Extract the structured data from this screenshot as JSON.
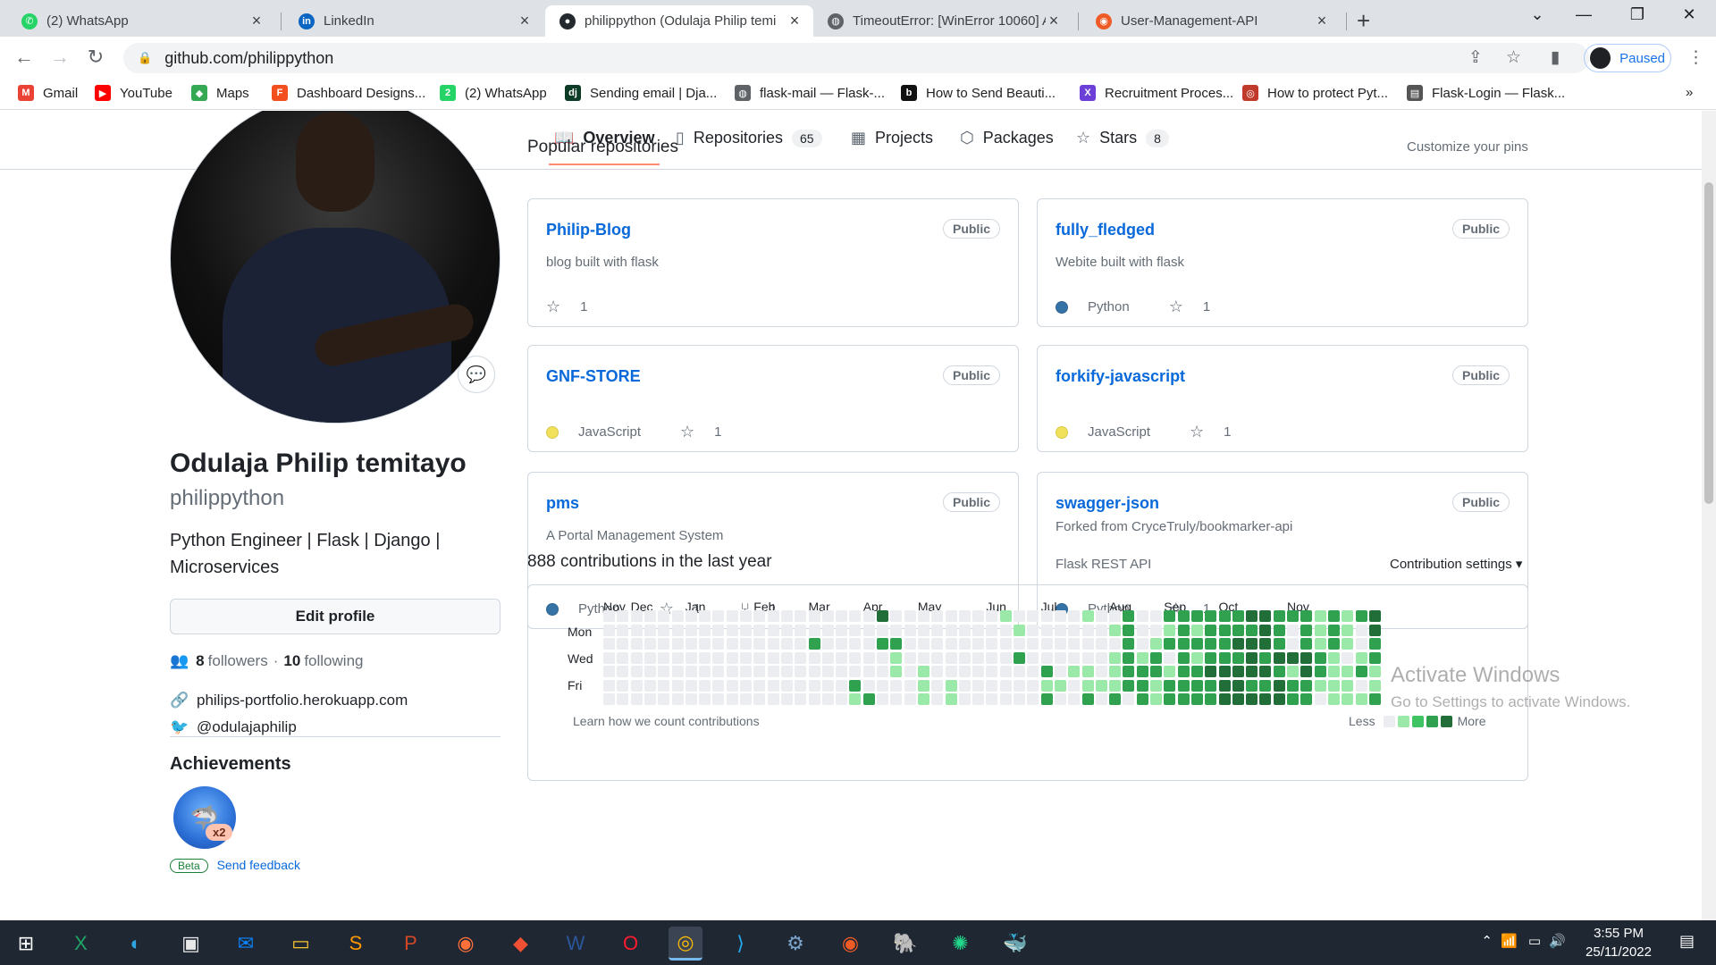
{
  "browser": {
    "tabs": [
      {
        "title": "(2) WhatsApp",
        "icon": "whatsapp-icon",
        "color": "#25d366",
        "glyph": "✆"
      },
      {
        "title": "LinkedIn",
        "icon": "linkedin-icon",
        "color": "#0a66c2",
        "glyph": "in"
      },
      {
        "title": "philippython (Odulaja Philip temi",
        "icon": "github-icon",
        "color": "#24292f",
        "glyph": "●"
      },
      {
        "title": "TimeoutError: [WinError 10060] A",
        "icon": "globe-icon",
        "color": "#5f6368",
        "glyph": "◍"
      },
      {
        "title": "User-Management-API",
        "icon": "postman-icon",
        "color": "#ef5b25",
        "glyph": "◉"
      }
    ],
    "url": "github.com/philippython",
    "profile_status": "Paused",
    "bookmarks": [
      {
        "label": "Gmail",
        "icon": "gmail-icon",
        "color": "#ea4335",
        "glyph": "M"
      },
      {
        "label": "YouTube",
        "icon": "youtube-icon",
        "color": "#ff0000",
        "glyph": "▶"
      },
      {
        "label": "Maps",
        "icon": "maps-icon",
        "color": "#34a853",
        "glyph": "◆"
      },
      {
        "label": "Dashboard Designs...",
        "icon": "figma-icon",
        "color": "#f24e1e",
        "glyph": "F"
      },
      {
        "label": "(2) WhatsApp",
        "icon": "whatsapp-icon",
        "color": "#25d366",
        "glyph": "2"
      },
      {
        "label": "Sending email | Dja...",
        "icon": "django-icon",
        "color": "#0c3c26",
        "glyph": "dj"
      },
      {
        "label": "flask-mail — Flask-...",
        "icon": "globe-icon",
        "color": "#5f6368",
        "glyph": "◍"
      },
      {
        "label": "How to Send Beauti...",
        "icon": "bds-icon",
        "color": "#111111",
        "glyph": "b"
      },
      {
        "label": "Recruitment Proces...",
        "icon": "x-icon",
        "color": "#6b3fd8",
        "glyph": "X"
      },
      {
        "label": "How to protect Pyt...",
        "icon": "site-icon",
        "color": "#c0392b",
        "glyph": "◎"
      },
      {
        "label": "Flask-Login — Flask...",
        "icon": "book-icon",
        "color": "#555555",
        "glyph": "▤"
      }
    ]
  },
  "github": {
    "tabs": [
      {
        "label": "Overview",
        "count": "",
        "icon": "book-icon",
        "glyph": "📖"
      },
      {
        "label": "Repositories",
        "count": "65",
        "icon": "repo-icon",
        "glyph": "▯"
      },
      {
        "label": "Projects",
        "count": "",
        "icon": "table-icon",
        "glyph": "▦"
      },
      {
        "label": "Packages",
        "count": "",
        "icon": "package-icon",
        "glyph": "⬡"
      },
      {
        "label": "Stars",
        "count": "8",
        "icon": "star-icon",
        "glyph": "☆"
      }
    ],
    "profile": {
      "fullname": "Odulaja Philip temitayo",
      "username": "philippython",
      "bio": "Python Engineer | Flask | Django | Microservices",
      "edit_button": "Edit profile",
      "followers_count": "8",
      "followers_label": "followers",
      "separator": "·",
      "following_count": "10",
      "following_label": "following",
      "website": "philips-portfolio.herokuapp.com",
      "twitter": "@odulajaphilip",
      "achievements_title": "Achievements",
      "badge_count": "x2",
      "beta_label": "Beta",
      "feedback_label": "Send feedback"
    },
    "popular": {
      "title": "Popular repositories",
      "customize": "Customize your pins",
      "repos": [
        {
          "name": "Philip-Blog",
          "visibility": "Public",
          "forked_from": "",
          "description": "blog built with flask",
          "language": "",
          "lang_color": "",
          "stars": "1",
          "forks": ""
        },
        {
          "name": "fully_fledged",
          "visibility": "Public",
          "forked_from": "",
          "description": "Webite built with flask",
          "language": "Python",
          "lang_color": "#3572A5",
          "stars": "1",
          "forks": ""
        },
        {
          "name": "GNF-STORE",
          "visibility": "Public",
          "forked_from": "",
          "description": "",
          "language": "JavaScript",
          "lang_color": "#f1e05a",
          "stars": "1",
          "forks": ""
        },
        {
          "name": "forkify-javascript",
          "visibility": "Public",
          "forked_from": "",
          "description": "",
          "language": "JavaScript",
          "lang_color": "#f1e05a",
          "stars": "1",
          "forks": ""
        },
        {
          "name": "pms",
          "visibility": "Public",
          "forked_from": "",
          "description": "A Portal Management System",
          "language": "Python",
          "lang_color": "#3572A5",
          "stars": "1",
          "forks": "1"
        },
        {
          "name": "swagger-json",
          "visibility": "Public",
          "forked_from": "Forked from CryceTruly/bookmarker-api",
          "description": "Flask REST API",
          "language": "Python",
          "lang_color": "#3572A5",
          "stars": "1",
          "forks": ""
        }
      ]
    },
    "contributions": {
      "title": "888 contributions in the last year",
      "settings": "Contribution settings ▾",
      "months": [
        "Nov",
        "Dec",
        "Jan",
        "Feb",
        "Mar",
        "Apr",
        "May",
        "Jun",
        "Jul",
        "Aug",
        "Sep",
        "Oct",
        "Nov"
      ],
      "month_weeks": [
        0,
        2,
        6,
        11,
        15,
        19,
        23,
        28,
        32,
        37,
        41,
        45,
        50
      ],
      "days": [
        "Mon",
        "Wed",
        "Fri"
      ],
      "learn": "Learn how we count contributions",
      "less": "Less",
      "more": "More",
      "colors": [
        "#ebedf0",
        "#9be9a8",
        "#40c463",
        "#30a14e",
        "#216e39"
      ],
      "weeks": [
        [
          0,
          0,
          0,
          0,
          0,
          0,
          0
        ],
        [
          0,
          0,
          0,
          0,
          0,
          0,
          0
        ],
        [
          0,
          0,
          0,
          0,
          0,
          0,
          0
        ],
        [
          0,
          0,
          0,
          0,
          0,
          0,
          0
        ],
        [
          0,
          0,
          0,
          0,
          0,
          0,
          0
        ],
        [
          0,
          0,
          0,
          0,
          0,
          0,
          0
        ],
        [
          0,
          0,
          0,
          0,
          0,
          0,
          0
        ],
        [
          0,
          0,
          0,
          0,
          0,
          0,
          0
        ],
        [
          0,
          0,
          0,
          0,
          0,
          0,
          0
        ],
        [
          0,
          0,
          0,
          0,
          0,
          0,
          0
        ],
        [
          0,
          0,
          0,
          0,
          0,
          0,
          0
        ],
        [
          0,
          0,
          0,
          0,
          0,
          0,
          0
        ],
        [
          0,
          0,
          0,
          0,
          0,
          0,
          0
        ],
        [
          0,
          0,
          0,
          0,
          0,
          0,
          0
        ],
        [
          0,
          0,
          0,
          0,
          0,
          0,
          0
        ],
        [
          0,
          0,
          3,
          0,
          0,
          0,
          0
        ],
        [
          0,
          0,
          0,
          0,
          0,
          0,
          0
        ],
        [
          0,
          0,
          0,
          0,
          0,
          0,
          0
        ],
        [
          0,
          0,
          0,
          0,
          0,
          3,
          1
        ],
        [
          0,
          0,
          0,
          0,
          0,
          0,
          3
        ],
        [
          4,
          0,
          3,
          0,
          0,
          0,
          0
        ],
        [
          0,
          0,
          3,
          1,
          1,
          0,
          0
        ],
        [
          0,
          0,
          0,
          0,
          0,
          0,
          0
        ],
        [
          0,
          0,
          0,
          0,
          1,
          1,
          1
        ],
        [
          0,
          0,
          0,
          0,
          0,
          0,
          0
        ],
        [
          0,
          0,
          0,
          0,
          0,
          1,
          1
        ],
        [
          0,
          0,
          0,
          0,
          0,
          0,
          0
        ],
        [
          0,
          0,
          0,
          0,
          0,
          0,
          0
        ],
        [
          0,
          0,
          0,
          0,
          0,
          0,
          0
        ],
        [
          1,
          0,
          0,
          0,
          0,
          0,
          0
        ],
        [
          0,
          1,
          0,
          3,
          0,
          0,
          0
        ],
        [
          0,
          0,
          0,
          0,
          0,
          0,
          0
        ],
        [
          0,
          0,
          0,
          0,
          3,
          1,
          3
        ],
        [
          0,
          0,
          0,
          0,
          0,
          1,
          0
        ],
        [
          0,
          0,
          0,
          0,
          1,
          0,
          0
        ],
        [
          1,
          0,
          0,
          0,
          1,
          1,
          3
        ],
        [
          0,
          0,
          0,
          0,
          0,
          1,
          0
        ],
        [
          0,
          1,
          0,
          1,
          1,
          1,
          3
        ],
        [
          3,
          3,
          3,
          3,
          3,
          3,
          0
        ],
        [
          0,
          0,
          0,
          1,
          3,
          3,
          3
        ],
        [
          0,
          0,
          1,
          3,
          3,
          1,
          1
        ],
        [
          3,
          1,
          3,
          0,
          1,
          3,
          3
        ],
        [
          3,
          3,
          3,
          3,
          3,
          3,
          3
        ],
        [
          3,
          1,
          3,
          1,
          3,
          3,
          3
        ],
        [
          3,
          3,
          3,
          3,
          4,
          3,
          3
        ],
        [
          3,
          3,
          3,
          3,
          4,
          4,
          4
        ],
        [
          3,
          3,
          4,
          3,
          4,
          4,
          4
        ],
        [
          4,
          3,
          4,
          4,
          4,
          3,
          4
        ],
        [
          4,
          4,
          4,
          3,
          4,
          3,
          4
        ],
        [
          3,
          3,
          3,
          4,
          3,
          4,
          4
        ],
        [
          3,
          0,
          0,
          4,
          1,
          3,
          3
        ],
        [
          3,
          3,
          3,
          4,
          4,
          3,
          3
        ],
        [
          1,
          1,
          1,
          3,
          3,
          1,
          0
        ],
        [
          3,
          3,
          3,
          1,
          1,
          1,
          1
        ],
        [
          1,
          1,
          1,
          0,
          1,
          1,
          1
        ],
        [
          3,
          0,
          0,
          1,
          3,
          0,
          1
        ],
        [
          4,
          4,
          3,
          3,
          1,
          1,
          3
        ]
      ]
    },
    "watermark": {
      "line1": "Activate Windows",
      "line2": "Go to Settings to activate Windows."
    }
  },
  "taskbar": {
    "time": "3:55 PM",
    "date": "25/11/2022",
    "apps": [
      {
        "icon": "windows-start-icon",
        "glyph": "⊞",
        "color": "#ffffff"
      },
      {
        "icon": "excel-icon",
        "glyph": "X",
        "color": "#21a366"
      },
      {
        "icon": "edge-icon",
        "glyph": "◐",
        "color": "#2ca5e0"
      },
      {
        "icon": "store-icon",
        "glyph": "▣",
        "color": "#e8e8e8"
      },
      {
        "icon": "mail-icon",
        "glyph": "✉",
        "color": "#0a84ff"
      },
      {
        "icon": "file-explorer-icon",
        "glyph": "▭",
        "color": "#f4c430"
      },
      {
        "icon": "sublime-icon",
        "glyph": "S",
        "color": "#ff9800"
      },
      {
        "icon": "powerpoint-icon",
        "glyph": "P",
        "color": "#d24726"
      },
      {
        "icon": "firefox-icon",
        "glyph": "◉",
        "color": "#ff7139"
      },
      {
        "icon": "git-icon",
        "glyph": "◆",
        "color": "#f05033"
      },
      {
        "icon": "word-icon",
        "glyph": "W",
        "color": "#2b579a"
      },
      {
        "icon": "opera-icon",
        "glyph": "O",
        "color": "#ff1b2d"
      },
      {
        "icon": "chrome-icon",
        "glyph": "◎",
        "color": "#fbbc05"
      },
      {
        "icon": "vscode-icon",
        "glyph": "⟩",
        "color": "#23a9f2"
      },
      {
        "icon": "mysql-workbench-icon",
        "glyph": "⚙",
        "color": "#7aa3cc"
      },
      {
        "icon": "postman-icon",
        "glyph": "◉",
        "color": "#ef5b25"
      },
      {
        "icon": "postgres-icon",
        "glyph": "🐘",
        "color": "#8fb3d9"
      },
      {
        "icon": "pycharm-icon",
        "glyph": "✺",
        "color": "#21d789"
      },
      {
        "icon": "docker-icon",
        "glyph": "🐳",
        "color": "#2496ed"
      }
    ]
  }
}
